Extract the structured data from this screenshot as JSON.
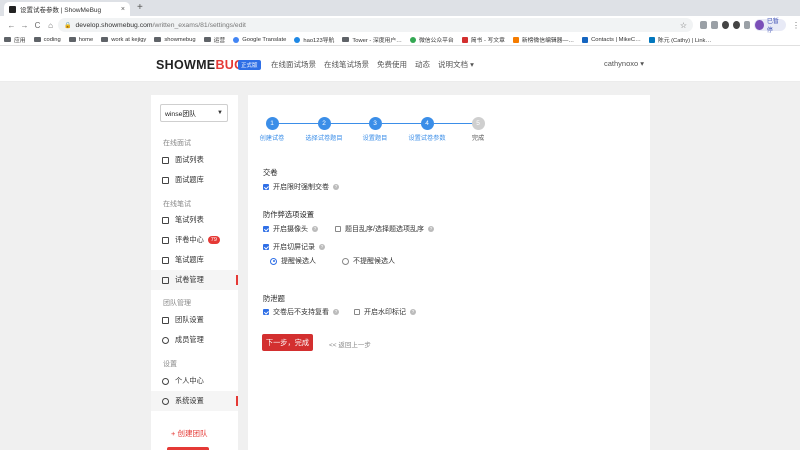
{
  "browser": {
    "tab_title": "设置试卷参数 | ShowMeBug",
    "tab_close": "×",
    "new_tab": "+",
    "nav": {
      "back": "←",
      "forward": "→",
      "reload": "C",
      "home": "⌂"
    },
    "url_host": "develop.showmebug.com",
    "url_path": "/written_exams/81/settings/edit",
    "star": "☆",
    "paused_label": "已暂停",
    "menu": "⋮"
  },
  "bookmarks": [
    {
      "label": "应用",
      "icon": "apps-icon"
    },
    {
      "label": "coding",
      "icon": "folder-icon"
    },
    {
      "label": "home",
      "icon": "folder-icon"
    },
    {
      "label": "work at kejigy",
      "icon": "folder-icon"
    },
    {
      "label": "showmebug",
      "icon": "folder-icon"
    },
    {
      "label": "运营",
      "icon": "folder-icon"
    },
    {
      "label": "Google Translate",
      "icon": "translate-icon"
    },
    {
      "label": "hao123导航",
      "icon": "hao123-icon"
    },
    {
      "label": "Tower - 深度用户…",
      "icon": "tower-icon"
    },
    {
      "label": "微信公众平台",
      "icon": "wechat-icon"
    },
    {
      "label": "简书 - 写文章",
      "icon": "jianshu-icon"
    },
    {
      "label": "新榜微信编辑器—…",
      "icon": "xinbang-icon"
    },
    {
      "label": "Contacts | MikeC…",
      "icon": "contacts-icon"
    },
    {
      "label": "陈元 (Cathy) | Link…",
      "icon": "linkedin-icon"
    }
  ],
  "site": {
    "logo_main": "SHOWME",
    "logo_accent": "BUG",
    "badge": "正式版",
    "nav": [
      "在线面试场景",
      "在线笔试场景",
      "免费使用",
      "动态",
      "说明文档 ▾"
    ],
    "user": "cathynoxo ▾"
  },
  "sidebar": {
    "team_select": "winse团队",
    "groups": {
      "interview": "在线面试",
      "written": "在线笔试",
      "team": "团队管理",
      "settings": "设置"
    },
    "items": [
      {
        "label": "面试列表"
      },
      {
        "label": "面试题库"
      },
      {
        "label": "笔试列表"
      },
      {
        "label": "评卷中心",
        "count": "79"
      },
      {
        "label": "笔试题库"
      },
      {
        "label": "试卷管理"
      },
      {
        "label": "团队设置"
      },
      {
        "label": "成员管理"
      },
      {
        "label": "个人中心"
      },
      {
        "label": "系统设置"
      }
    ],
    "create_team": "+ 创建团队"
  },
  "steps": [
    {
      "num": "1",
      "label": "创建试卷",
      "done": true
    },
    {
      "num": "2",
      "label": "选择试卷题目",
      "done": true
    },
    {
      "num": "3",
      "label": "设置题目",
      "done": true
    },
    {
      "num": "4",
      "label": "设置试卷参数",
      "done": true
    },
    {
      "num": "5",
      "label": "完成",
      "done": false
    }
  ],
  "form": {
    "submit_section": "交卷",
    "force_submit": "开启限时强制交卷",
    "anticheat_section": "防作弊选项设置",
    "camera": "开启摄像头",
    "shuffle": "题目乱序/选择题选项乱序",
    "screen_switch": "开启切屏记录",
    "remind": "提醒候选人",
    "no_remind": "不提醒候选人",
    "leak_section": "防泄题",
    "no_review": "交卷后不支持复看",
    "watermark": "开启水印标记",
    "help": "?"
  },
  "actions": {
    "next": "下一步，完成",
    "back": "<< 返回上一步"
  }
}
